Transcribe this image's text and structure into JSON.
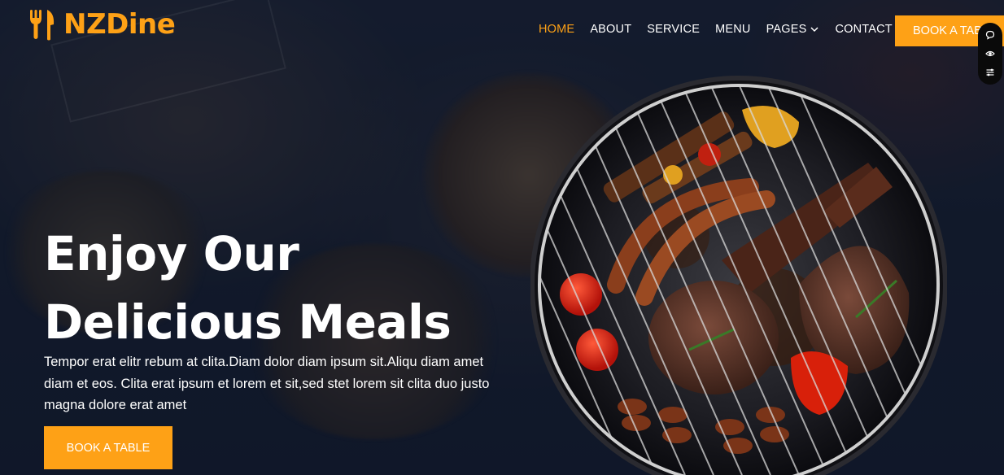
{
  "brand": {
    "name": "NZDine",
    "icon": "fork-knife-icon",
    "color": "#FEA116"
  },
  "nav": {
    "links": [
      {
        "label": "HOME",
        "active": true
      },
      {
        "label": "ABOUT",
        "active": false
      },
      {
        "label": "SERVICE",
        "active": false
      },
      {
        "label": "MENU",
        "active": false
      },
      {
        "label": "PAGES",
        "active": false,
        "dropdown": true
      },
      {
        "label": "CONTACT",
        "active": false
      }
    ],
    "cta_label": "BOOK A TABLE"
  },
  "side_widget": {
    "icons": [
      "chat-icon",
      "eye-icon",
      "sliders-icon"
    ]
  },
  "hero": {
    "title_line1": "Enjoy Our",
    "title_line2": "Delicious Meals",
    "description": "Tempor erat elitr rebum at clita.Diam dolor diam ipsum sit.Aliqu diam amet diam et eos. Clita erat ipsum et lorem et sit,sed stet lorem sit clita duo justo magna dolore erat amet",
    "cta_label": "BOOK A TABLE",
    "image": "grill-bbq-image"
  },
  "colors": {
    "accent": "#FEA116",
    "background": "#0f172b",
    "text": "#ffffff"
  }
}
